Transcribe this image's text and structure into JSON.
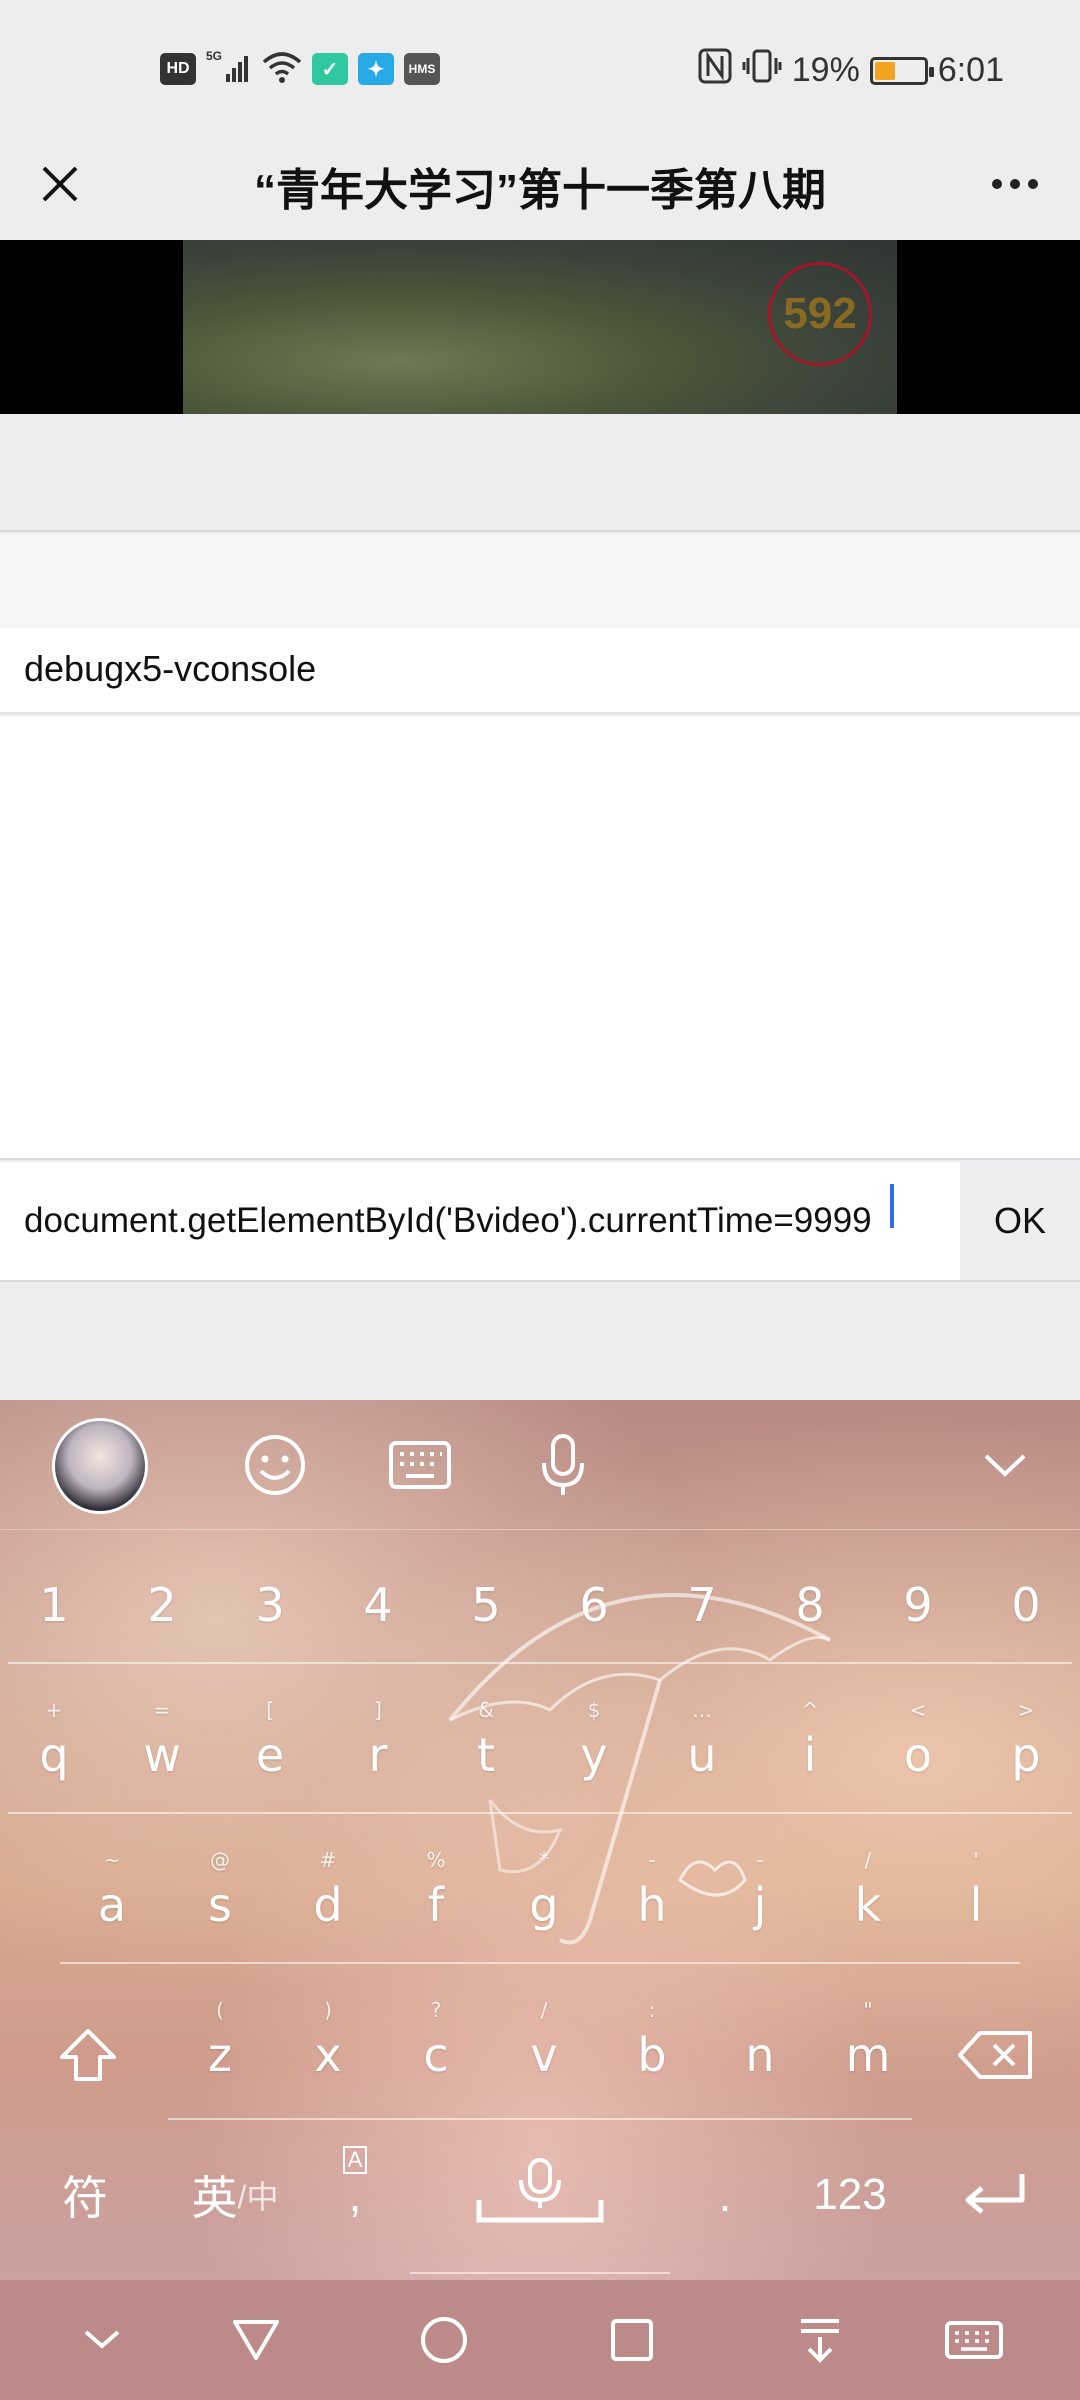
{
  "status_bar": {
    "left_chips": [
      "HD",
      "5G",
      "HMS"
    ],
    "battery_percent": "19%",
    "time": "6:01",
    "battery_level": 0.19
  },
  "titlebar": {
    "title": "“青年大学习”第十一季第八期",
    "close_icon": "close-icon",
    "more_icon": "more-icon"
  },
  "video": {
    "counter": "592"
  },
  "console": {
    "header": "debugx5-vconsole",
    "command": "document.getElementById('Bvideo').currentTime=9999",
    "ok_label": "OK"
  },
  "keyboard": {
    "toolbar": [
      "avatar",
      "emoji-icon",
      "keyboard-icon",
      "microphone-icon",
      "collapse-icon"
    ],
    "number_row": [
      "1",
      "2",
      "3",
      "4",
      "5",
      "6",
      "7",
      "8",
      "9",
      "0"
    ],
    "row_q": [
      {
        "hint": "+",
        "key": "q"
      },
      {
        "hint": "=",
        "key": "w"
      },
      {
        "hint": "[",
        "key": "e"
      },
      {
        "hint": "]",
        "key": "r"
      },
      {
        "hint": "&",
        "key": "t"
      },
      {
        "hint": "$",
        "key": "y"
      },
      {
        "hint": "…",
        "key": "u"
      },
      {
        "hint": "^",
        "key": "i"
      },
      {
        "hint": "<",
        "key": "o"
      },
      {
        "hint": ">",
        "key": "p"
      }
    ],
    "row_a": [
      {
        "hint": "~",
        "key": "a"
      },
      {
        "hint": "@",
        "key": "s"
      },
      {
        "hint": "#",
        "key": "d"
      },
      {
        "hint": "%",
        "key": "f"
      },
      {
        "hint": "*",
        "key": "g"
      },
      {
        "hint": "-",
        "key": "h"
      },
      {
        "hint": "-",
        "key": "j"
      },
      {
        "hint": "/",
        "key": "k"
      },
      {
        "hint": "'",
        "key": "l"
      }
    ],
    "row_z": [
      {
        "hint": "(",
        "key": "z"
      },
      {
        "hint": ")",
        "key": "x"
      },
      {
        "hint": "?",
        "key": "c"
      },
      {
        "hint": "/",
        "key": "v"
      },
      {
        "hint": ":",
        "key": "b"
      },
      {
        "hint": "",
        "key": "n"
      },
      {
        "hint": "\"",
        "key": "m"
      }
    ],
    "bottom": {
      "symbols": "符",
      "lang_en": "英",
      "lang_cn": "/中",
      "comma": ",",
      "period": ".",
      "num": "123"
    }
  },
  "navbar": [
    "chevron-down-icon",
    "back-icon",
    "home-icon",
    "recents-icon",
    "download-icon",
    "keyboard-icon"
  ]
}
